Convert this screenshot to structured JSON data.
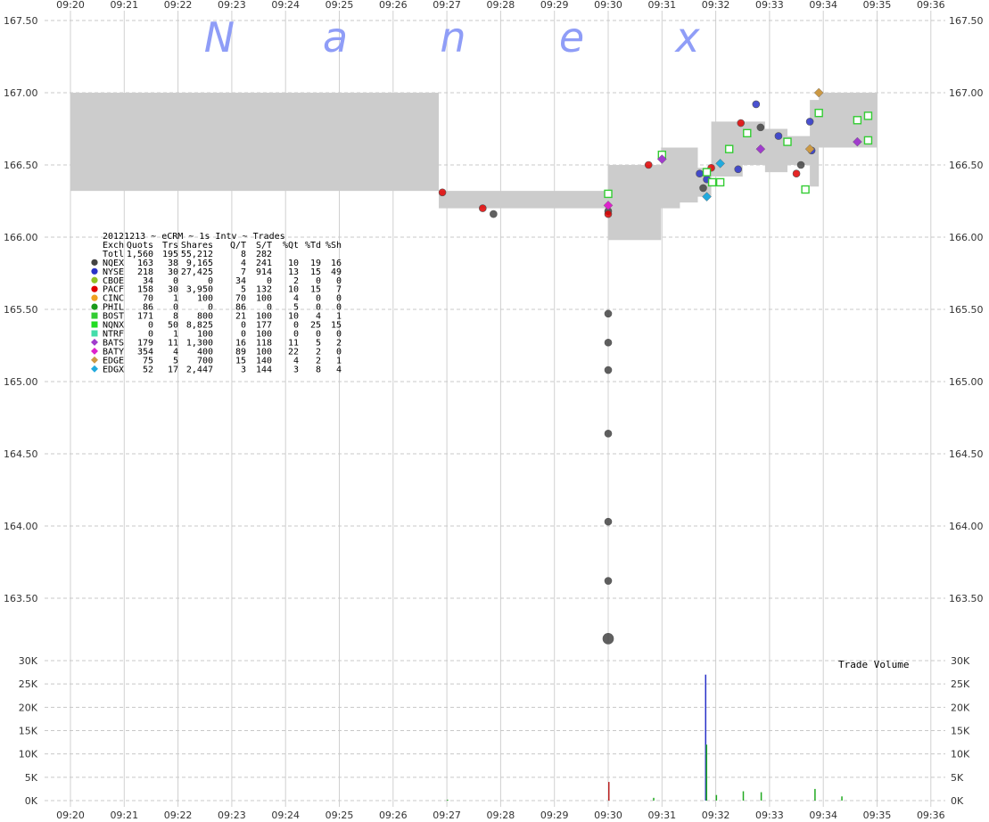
{
  "chart_data": {
    "type": "scatter",
    "watermark": [
      "N",
      "a",
      "n",
      "e",
      "x"
    ],
    "x_ticks": [
      "09:20",
      "09:21",
      "09:22",
      "09:23",
      "09:24",
      "09:25",
      "09:26",
      "09:27",
      "09:28",
      "09:29",
      "09:30",
      "09:31",
      "09:32",
      "09:33",
      "09:34",
      "09:35",
      "09:36"
    ],
    "price_axis": {
      "ylim": [
        163.0,
        167.6
      ],
      "ticks": [
        "167.50",
        "167.00",
        "166.50",
        "166.00",
        "165.50",
        "165.00",
        "164.50",
        "164.00",
        "163.50"
      ],
      "grid": true
    },
    "volume_axis": {
      "ylim": [
        0,
        30000
      ],
      "ticks": [
        "30K",
        "25K",
        "20K",
        "15K",
        "10K",
        "5K",
        "0K"
      ],
      "label": "Trade Volume",
      "grid": true
    },
    "nbbo_band": [
      {
        "t": "09:20:00",
        "bid": 166.32,
        "ask": 167.0
      },
      {
        "t": "09:26:50",
        "bid": 166.32,
        "ask": 167.0
      },
      {
        "t": "09:26:51",
        "bid": 166.2,
        "ask": 166.32
      },
      {
        "t": "09:29:59",
        "bid": 166.16,
        "ask": 166.32
      },
      {
        "t": "09:30:00",
        "bid": 165.98,
        "ask": 166.5
      },
      {
        "t": "09:30:58",
        "bid": 165.98,
        "ask": 166.5
      },
      {
        "t": "09:30:59",
        "bid": 166.2,
        "ask": 166.62
      },
      {
        "t": "09:31:20",
        "bid": 166.24,
        "ask": 166.62
      },
      {
        "t": "09:31:40",
        "bid": 166.28,
        "ask": 166.48
      },
      {
        "t": "09:31:55",
        "bid": 166.42,
        "ask": 166.8
      },
      {
        "t": "09:32:30",
        "bid": 166.5,
        "ask": 166.8
      },
      {
        "t": "09:32:55",
        "bid": 166.45,
        "ask": 166.75
      },
      {
        "t": "09:33:20",
        "bid": 166.5,
        "ask": 166.7
      },
      {
        "t": "09:33:45",
        "bid": 166.35,
        "ask": 166.95
      },
      {
        "t": "09:33:55",
        "bid": 166.62,
        "ask": 167.0
      },
      {
        "t": "09:35:00",
        "bid": 166.62,
        "ask": 167.0
      }
    ],
    "series": [
      {
        "name": "NQEX",
        "color": "#444444",
        "marker": "circle",
        "points": [
          [
            "09:27:52",
            166.16
          ],
          [
            "09:30:00",
            166.18
          ],
          [
            "09:30:00",
            165.47
          ],
          [
            "09:30:00",
            165.27
          ],
          [
            "09:30:00",
            165.08
          ],
          [
            "09:30:00",
            164.64
          ],
          [
            "09:30:00",
            164.03
          ],
          [
            "09:30:00",
            163.62
          ],
          [
            "09:30:00",
            163.22
          ],
          [
            "09:31:46",
            166.34
          ],
          [
            "09:32:50",
            166.76
          ],
          [
            "09:33:35",
            166.5
          ]
        ]
      },
      {
        "name": "NYSE",
        "color": "#2a32c8",
        "marker": "circle",
        "points": [
          [
            "09:31:42",
            166.44
          ],
          [
            "09:31:50",
            166.4
          ],
          [
            "09:32:25",
            166.47
          ],
          [
            "09:32:45",
            166.92
          ],
          [
            "09:33:10",
            166.7
          ],
          [
            "09:33:45",
            166.8
          ],
          [
            "09:33:47",
            166.6
          ]
        ]
      },
      {
        "name": "CBOE",
        "color": "#8fc224",
        "marker": "circle",
        "points": []
      },
      {
        "name": "PACF",
        "color": "#e00000",
        "marker": "circle",
        "points": [
          [
            "09:26:55",
            166.31
          ],
          [
            "09:27:40",
            166.2
          ],
          [
            "09:30:00",
            166.16
          ],
          [
            "09:30:45",
            166.5
          ],
          [
            "09:31:55",
            166.48
          ],
          [
            "09:32:28",
            166.79
          ],
          [
            "09:33:30",
            166.44
          ]
        ]
      },
      {
        "name": "CINC",
        "color": "#f0a020",
        "marker": "circle",
        "points": []
      },
      {
        "name": "PHIL",
        "color": "#1a9a1a",
        "marker": "circle",
        "points": []
      },
      {
        "name": "BOST",
        "color": "#33cc33",
        "marker": "square",
        "points": [
          [
            "09:30:00",
            166.3
          ],
          [
            "09:31:00",
            166.57
          ],
          [
            "09:31:50",
            166.45
          ],
          [
            "09:31:56",
            166.38
          ],
          [
            "09:32:05",
            166.38
          ],
          [
            "09:32:15",
            166.61
          ],
          [
            "09:32:35",
            166.72
          ],
          [
            "09:33:20",
            166.66
          ],
          [
            "09:33:40",
            166.33
          ],
          [
            "09:33:55",
            166.86
          ],
          [
            "09:34:38",
            166.81
          ],
          [
            "09:34:50",
            166.84
          ],
          [
            "09:34:50",
            166.67
          ]
        ]
      },
      {
        "name": "NQNX",
        "color": "#22dd22",
        "marker": "square",
        "points": []
      },
      {
        "name": "NTRF",
        "color": "#44ddaa",
        "marker": "square",
        "points": []
      },
      {
        "name": "BATS",
        "color": "#a03ccc",
        "marker": "diamond",
        "points": [
          [
            "09:31:00",
            166.54
          ],
          [
            "09:32:50",
            166.61
          ],
          [
            "09:34:38",
            166.66
          ]
        ]
      },
      {
        "name": "BATY",
        "color": "#dd22cc",
        "marker": "diamond",
        "points": [
          [
            "09:30:00",
            166.22
          ]
        ]
      },
      {
        "name": "EDGE",
        "color": "#cc9944",
        "marker": "diamond",
        "points": [
          [
            "09:33:55",
            167.0
          ],
          [
            "09:33:45",
            166.61
          ]
        ]
      },
      {
        "name": "EDGX",
        "color": "#22aadd",
        "marker": "diamond",
        "points": [
          [
            "09:32:05",
            166.51
          ],
          [
            "09:31:50",
            166.28
          ]
        ]
      }
    ],
    "volume_bars": [
      {
        "t": "09:30:00",
        "v": 4000,
        "color": "#bb2222"
      },
      {
        "t": "09:31:48",
        "v": 27000,
        "color": "#2a32c8"
      },
      {
        "t": "09:31:49",
        "v": 12000,
        "color": "#22aa22"
      },
      {
        "t": "09:32:00",
        "v": 1200,
        "color": "#22aa22"
      },
      {
        "t": "09:32:30",
        "v": 2000,
        "color": "#22aa22"
      },
      {
        "t": "09:32:50",
        "v": 1800,
        "color": "#22aa22"
      },
      {
        "t": "09:33:50",
        "v": 2500,
        "color": "#22aa22"
      },
      {
        "t": "09:34:20",
        "v": 900,
        "color": "#22aa22"
      },
      {
        "t": "09:30:50",
        "v": 600,
        "color": "#22aa22"
      },
      {
        "t": "09:27:00",
        "v": 200,
        "color": "#22aa22"
      }
    ],
    "table": {
      "title": "20121213 ~ eCRM ~ 1s Intv ~ Trades",
      "header": [
        "Exch",
        "Quots",
        "Trs",
        "Shares",
        "Q/T",
        "S/T",
        "%Qt",
        "%Td",
        "%Sh"
      ],
      "rows": [
        [
          "Totl",
          "1,560",
          "195",
          "55,212",
          "8",
          "282",
          "",
          "",
          ""
        ],
        [
          "NQEX",
          "163",
          "38",
          "9,165",
          "4",
          "241",
          "10",
          "19",
          "16"
        ],
        [
          "NYSE",
          "218",
          "30",
          "27,425",
          "7",
          "914",
          "13",
          "15",
          "49"
        ],
        [
          "CBOE",
          "34",
          "0",
          "0",
          "34",
          "0",
          "2",
          "0",
          "0"
        ],
        [
          "PACF",
          "158",
          "30",
          "3,950",
          "5",
          "132",
          "10",
          "15",
          "7"
        ],
        [
          "CINC",
          "70",
          "1",
          "100",
          "70",
          "100",
          "4",
          "0",
          "0"
        ],
        [
          "PHIL",
          "86",
          "0",
          "0",
          "86",
          "0",
          "5",
          "0",
          "0"
        ],
        [
          "BOST",
          "171",
          "8",
          "800",
          "21",
          "100",
          "10",
          "4",
          "1"
        ],
        [
          "NQNX",
          "0",
          "50",
          "8,825",
          "0",
          "177",
          "0",
          "25",
          "15"
        ],
        [
          "NTRF",
          "0",
          "1",
          "100",
          "0",
          "100",
          "0",
          "0",
          "0"
        ],
        [
          "BATS",
          "179",
          "11",
          "1,300",
          "16",
          "118",
          "11",
          "5",
          "2"
        ],
        [
          "BATY",
          "354",
          "4",
          "400",
          "89",
          "100",
          "22",
          "2",
          "0"
        ],
        [
          "EDGE",
          "75",
          "5",
          "700",
          "15",
          "140",
          "4",
          "2",
          "1"
        ],
        [
          "EDGX",
          "52",
          "17",
          "2,447",
          "3",
          "144",
          "3",
          "8",
          "4"
        ]
      ]
    }
  }
}
